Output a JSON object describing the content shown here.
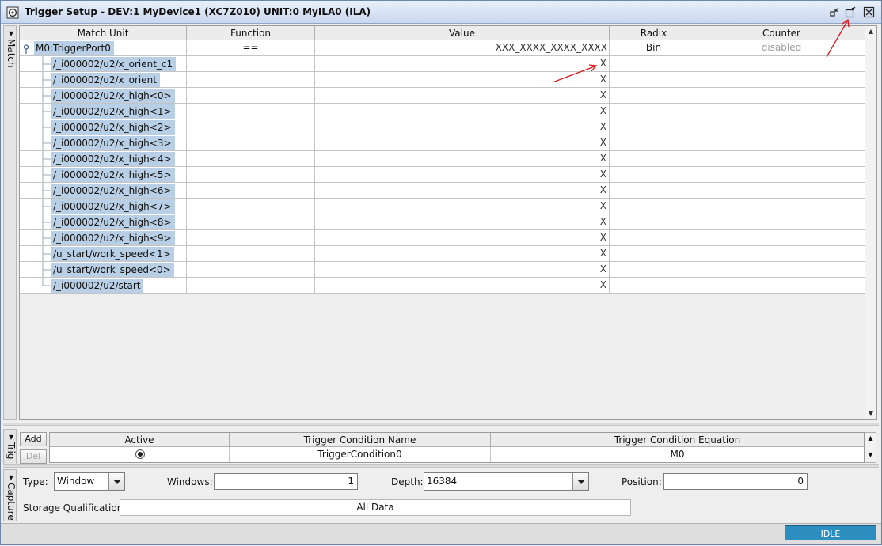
{
  "window": {
    "title": "Trigger Setup - DEV:1 MyDevice1 (XC7Z010) UNIT:0 MyILA0 (ILA)"
  },
  "side_tabs": {
    "match": "Match",
    "trig": "Trig",
    "capture": "Capture"
  },
  "match_table": {
    "columns": [
      "Match Unit",
      "Function",
      "Value",
      "Radix",
      "Counter"
    ],
    "port": {
      "name": "M0:TriggerPort0",
      "function": "==",
      "value": "XXX_XXXX_XXXX_XXXX",
      "radix": "Bin",
      "counter": "disabled"
    },
    "signals": [
      {
        "name": "/_i000002/u2/x_orient_c1",
        "value": "X"
      },
      {
        "name": "/_i000002/u2/x_orient",
        "value": "X"
      },
      {
        "name": "/_i000002/u2/x_high<0>",
        "value": "X"
      },
      {
        "name": "/_i000002/u2/x_high<1>",
        "value": "X"
      },
      {
        "name": "/_i000002/u2/x_high<2>",
        "value": "X"
      },
      {
        "name": "/_i000002/u2/x_high<3>",
        "value": "X"
      },
      {
        "name": "/_i000002/u2/x_high<4>",
        "value": "X"
      },
      {
        "name": "/_i000002/u2/x_high<5>",
        "value": "X"
      },
      {
        "name": "/_i000002/u2/x_high<6>",
        "value": "X"
      },
      {
        "name": "/_i000002/u2/x_high<7>",
        "value": "X"
      },
      {
        "name": "/_i000002/u2/x_high<8>",
        "value": "X"
      },
      {
        "name": "/_i000002/u2/x_high<9>",
        "value": "X"
      },
      {
        "name": "/u_start/work_speed<1>",
        "value": "X"
      },
      {
        "name": "/u_start/work_speed<0>",
        "value": "X"
      },
      {
        "name": "/_i000002/u2/start",
        "value": "X"
      }
    ]
  },
  "trigger": {
    "add_label": "Add",
    "del_label": "Del",
    "columns": [
      "Active",
      "Trigger Condition Name",
      "Trigger Condition Equation"
    ],
    "row": {
      "active": true,
      "name": "TriggerCondition0",
      "equation": "M0"
    }
  },
  "capture": {
    "type_label": "Type:",
    "type_value": "Window",
    "windows_label": "Windows:",
    "windows_value": "1",
    "depth_label": "Depth:",
    "depth_value": "16384",
    "position_label": "Position:",
    "position_value": "0",
    "storage_label": "Storage Qualification:",
    "storage_value": "All Data"
  },
  "status": {
    "state": "IDLE"
  },
  "colors": {
    "selection": "#b8cfe5",
    "annotation_arrow": "#e0161b",
    "status_idle": "#2d8fbf"
  }
}
